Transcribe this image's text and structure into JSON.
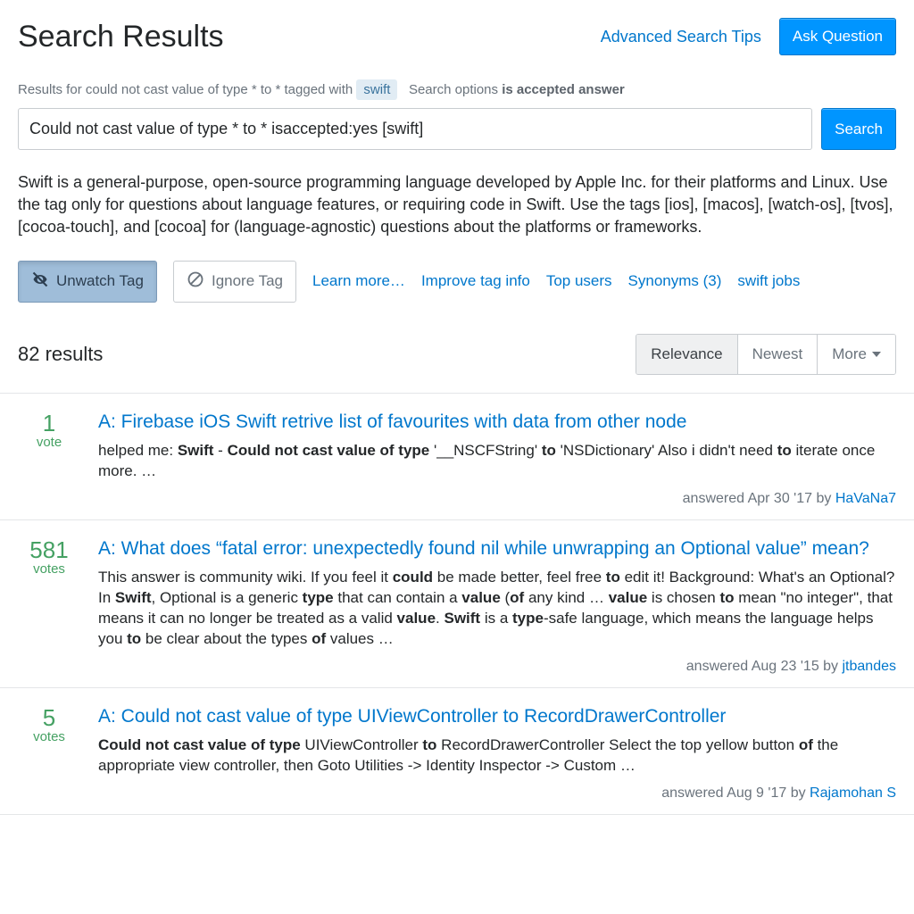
{
  "header": {
    "title": "Search Results",
    "advanced_tips": "Advanced Search Tips",
    "ask_question": "Ask Question"
  },
  "info": {
    "prefix": "Results for",
    "query_display": "could not cast value of type * to *",
    "tagged_with": "tagged with",
    "tag": "swift",
    "options_label": "Search options",
    "options_value": "is accepted answer"
  },
  "search": {
    "value": "Could not cast value of type * to * isaccepted:yes [swift]",
    "button": "Search"
  },
  "tag_desc": "Swift is a general-purpose, open-source programming language developed by Apple Inc. for their platforms and Linux. Use the tag only for questions about language features, or requiring code in Swift. Use the tags [ios], [macos], [watch-os], [tvos], [cocoa-touch], and [cocoa] for (language-agnostic) questions about the platforms or frameworks.",
  "tag_actions": {
    "unwatch": "Unwatch Tag",
    "ignore": "Ignore Tag",
    "learn_more": "Learn more…",
    "improve": "Improve tag info",
    "top_users": "Top users",
    "synonyms": "Synonyms (3)",
    "jobs": "swift jobs"
  },
  "results_count": "82 results",
  "tabs": {
    "relevance": "Relevance",
    "newest": "Newest",
    "more": "More"
  },
  "results": [
    {
      "votes": "1",
      "vote_label": "vote",
      "title": "A: Firebase iOS Swift retrive list of favourites with data from other node",
      "excerpt_html": "helped me: <b>Swift</b> - <b>Could not cast value of type</b> '__NSCFString' <b>to</b> 'NSDictionary' Also i didn't need <b>to</b> iterate once more. …",
      "answered": "answered Apr 30 '17 by ",
      "author": "HaVaNa7"
    },
    {
      "votes": "581",
      "vote_label": "votes",
      "title": "A: What does “fatal error: unexpectedly found nil while unwrapping an Optional value” mean?",
      "excerpt_html": "This answer is community wiki. If you feel it <b>could</b> be made better, feel free <b>to</b> edit it! Background: What's an Optional? In <b>Swift</b>, Optional is a generic <b>type</b> that can contain a <b>value</b> (<b>of</b> any kind … <b>value</b> is chosen <b>to</b> mean \"no integer\", that means it can no longer be treated as a valid <b>value</b>. <b>Swift</b> is a <b>type</b>-safe language, which means the language helps you <b>to</b> be clear about the types <b>of</b> values …",
      "answered": "answered Aug 23 '15 by ",
      "author": "jtbandes"
    },
    {
      "votes": "5",
      "vote_label": "votes",
      "title": "A: Could not cast value of type UIViewController to RecordDrawerController",
      "excerpt_html": "<b>Could not cast value of type</b> UIViewController <b>to</b> RecordDrawerController Select the top yellow button <b>of</b> the appropriate view controller, then Goto Utilities -> Identity Inspector -> Custom …",
      "answered": "answered Aug 9 '17 by ",
      "author": "Rajamohan S"
    }
  ]
}
